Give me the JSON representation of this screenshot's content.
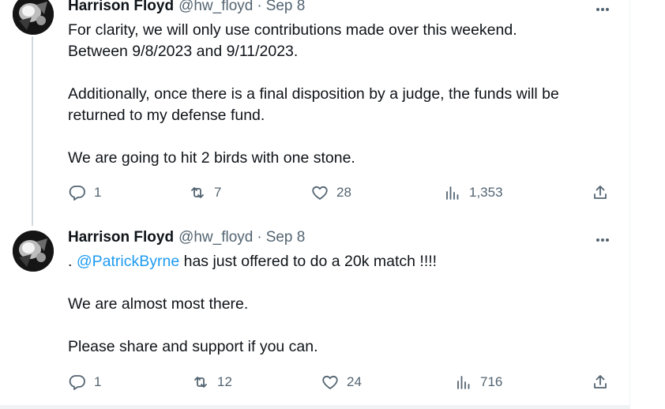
{
  "tweets": [
    {
      "author": {
        "name": "Harrison Floyd",
        "handle": "@hw_floyd"
      },
      "separator": "·",
      "date": "Sep 8",
      "paragraphs": [
        "For clarity, we will only use contributions made over this weekend.",
        "Between 9/8/2023 and 9/11/2023.",
        "Additionally, once there is a final disposition by a judge, the funds will be",
        "returned to my defense fund.",
        "We are going to hit 2 birds with one stone."
      ],
      "stats": {
        "replies": "1",
        "reposts": "7",
        "likes": "28",
        "views": "1,353"
      }
    },
    {
      "author": {
        "name": "Harrison Floyd",
        "handle": "@hw_floyd"
      },
      "separator": "·",
      "date": "Sep 8",
      "line1_prefix": ". ",
      "mention": "@PatrickByrne",
      "line1_suffix": " has just offered to do a 20k match !!!!",
      "paragraphs": [
        "We are almost most there.",
        "Please share and support if you can."
      ],
      "stats": {
        "replies": "1",
        "reposts": "12",
        "likes": "24",
        "views": "716"
      }
    }
  ],
  "icons": {
    "reply": "reply-icon",
    "repost": "repost-icon",
    "like": "heart-icon",
    "views": "views-icon",
    "share": "share-icon",
    "more": "more-icon"
  },
  "colors": {
    "text": "#0f1419",
    "secondary": "#536471",
    "link": "#1d9bf0",
    "border": "#eff3f4",
    "thread_line": "#cfd9de"
  }
}
